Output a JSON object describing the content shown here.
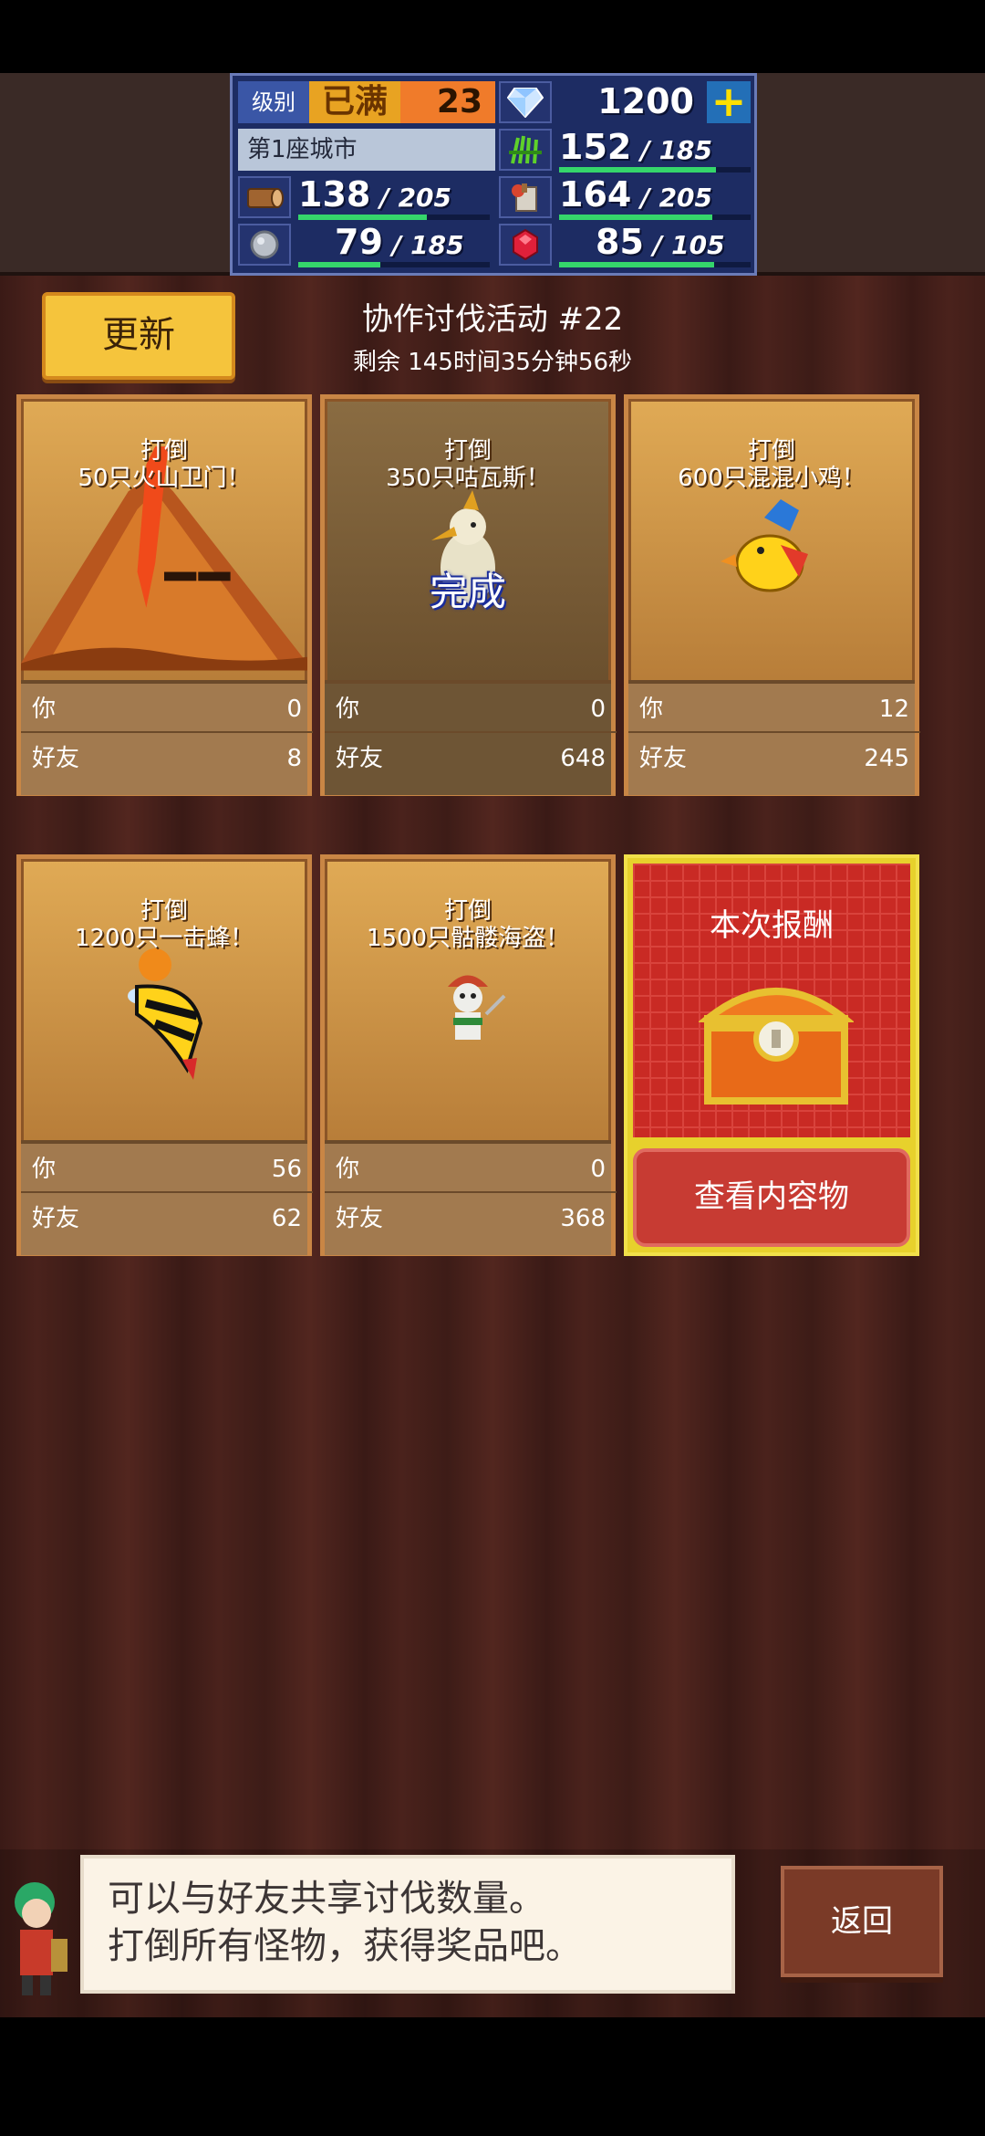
{
  "hud": {
    "level_label": "级别",
    "level_status": "已满",
    "level": "23",
    "gems": "1200",
    "plus_label": "+",
    "city": "第1座城市",
    "grass": {
      "value": "152",
      "max": "185",
      "fill": 0.82
    },
    "wood": {
      "value": "138",
      "max": "205",
      "fill": 0.67
    },
    "food": {
      "value": "164",
      "max": "205",
      "fill": 0.8
    },
    "stone": {
      "value": "79",
      "max": "185",
      "fill": 0.43
    },
    "ruby": {
      "value": "85",
      "max": "105",
      "fill": 0.81
    },
    "slash": "/"
  },
  "header": {
    "update_label": "更新",
    "title": "协作讨伐活动 #22",
    "remaining": "剩余 145时间35分钟56秒"
  },
  "cards": [
    {
      "line1": "打倒",
      "line2": "50只火山卫门！",
      "you": "0",
      "friend": "8",
      "done": false
    },
    {
      "line1": "打倒",
      "line2": "350只咕瓦斯！",
      "you": "0",
      "friend": "648",
      "done": true
    },
    {
      "line1": "打倒",
      "line2": "600只混混小鸡！",
      "you": "12",
      "friend": "245",
      "done": false
    },
    {
      "line1": "打倒",
      "line2": "1200只一击蜂！",
      "you": "56",
      "friend": "62",
      "done": false
    },
    {
      "line1": "打倒",
      "line2": "1500只骷髅海盗！",
      "you": "0",
      "friend": "368",
      "done": false
    }
  ],
  "labels": {
    "you": "你",
    "friend": "好友",
    "done": "完成"
  },
  "reward": {
    "title": "本次报酬",
    "button": "查看内容物"
  },
  "tip": {
    "line1": "可以与好友共享讨伐数量。",
    "line2": "打倒所有怪物，获得奖品吧。"
  },
  "back_label": "返回"
}
